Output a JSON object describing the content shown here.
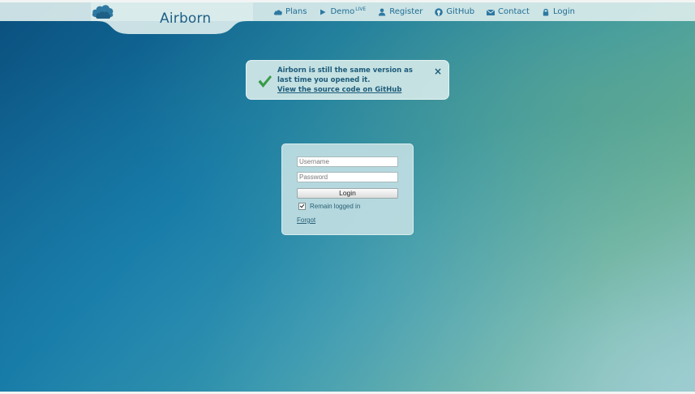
{
  "header": {
    "logo_text": "Airborn",
    "nav": [
      {
        "label": "Plans",
        "icon": "cloud-icon"
      },
      {
        "label": "Demo",
        "sup": "LIVE",
        "icon": "play-icon"
      },
      {
        "label": "Register",
        "icon": "user-icon"
      },
      {
        "label": "GitHub",
        "icon": "github-icon"
      },
      {
        "label": "Contact",
        "icon": "envelope-icon"
      },
      {
        "label": "Login",
        "icon": "lock-icon"
      }
    ]
  },
  "notification": {
    "message": "Airborn is still the same version as last time you opened it.",
    "link": "View the source code on GitHub",
    "close": "×"
  },
  "login": {
    "username_placeholder": "Username",
    "password_placeholder": "Password",
    "button_label": "Login",
    "remain_label": "Remain logged in",
    "remain_checked": true,
    "forgot_label": "Forgot"
  },
  "colors": {
    "accent": "#1e6d94",
    "check_green": "#3a9a4a"
  }
}
